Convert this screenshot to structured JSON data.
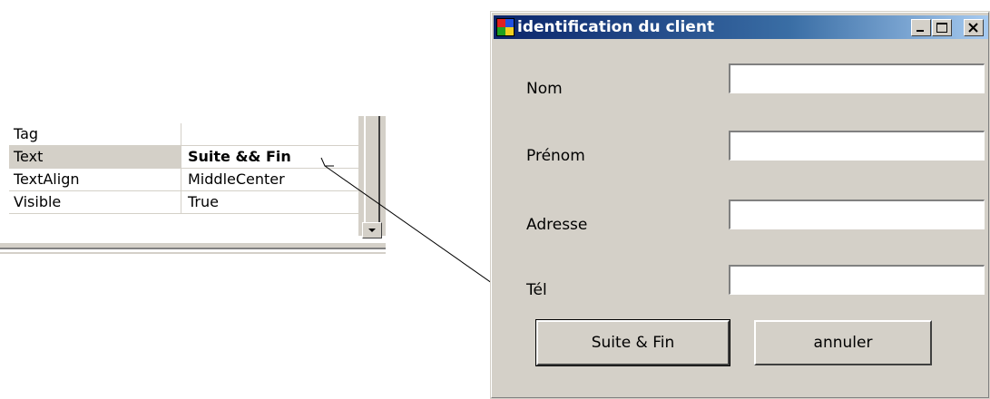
{
  "property_grid": {
    "rows": [
      {
        "name": "Tag",
        "value": ""
      },
      {
        "name": "Text",
        "value": "Suite && Fin"
      },
      {
        "name": "TextAlign",
        "value": "MiddleCenter"
      },
      {
        "name": "Visible",
        "value": "True"
      }
    ]
  },
  "window": {
    "title": "identification du client",
    "fields": [
      {
        "label": "Nom",
        "value": ""
      },
      {
        "label": "Prénom",
        "value": ""
      },
      {
        "label": "Adresse",
        "value": ""
      },
      {
        "label": "Tél",
        "value": ""
      }
    ],
    "buttons": {
      "suite": "Suite & Fin",
      "annuler": "annuler"
    }
  }
}
